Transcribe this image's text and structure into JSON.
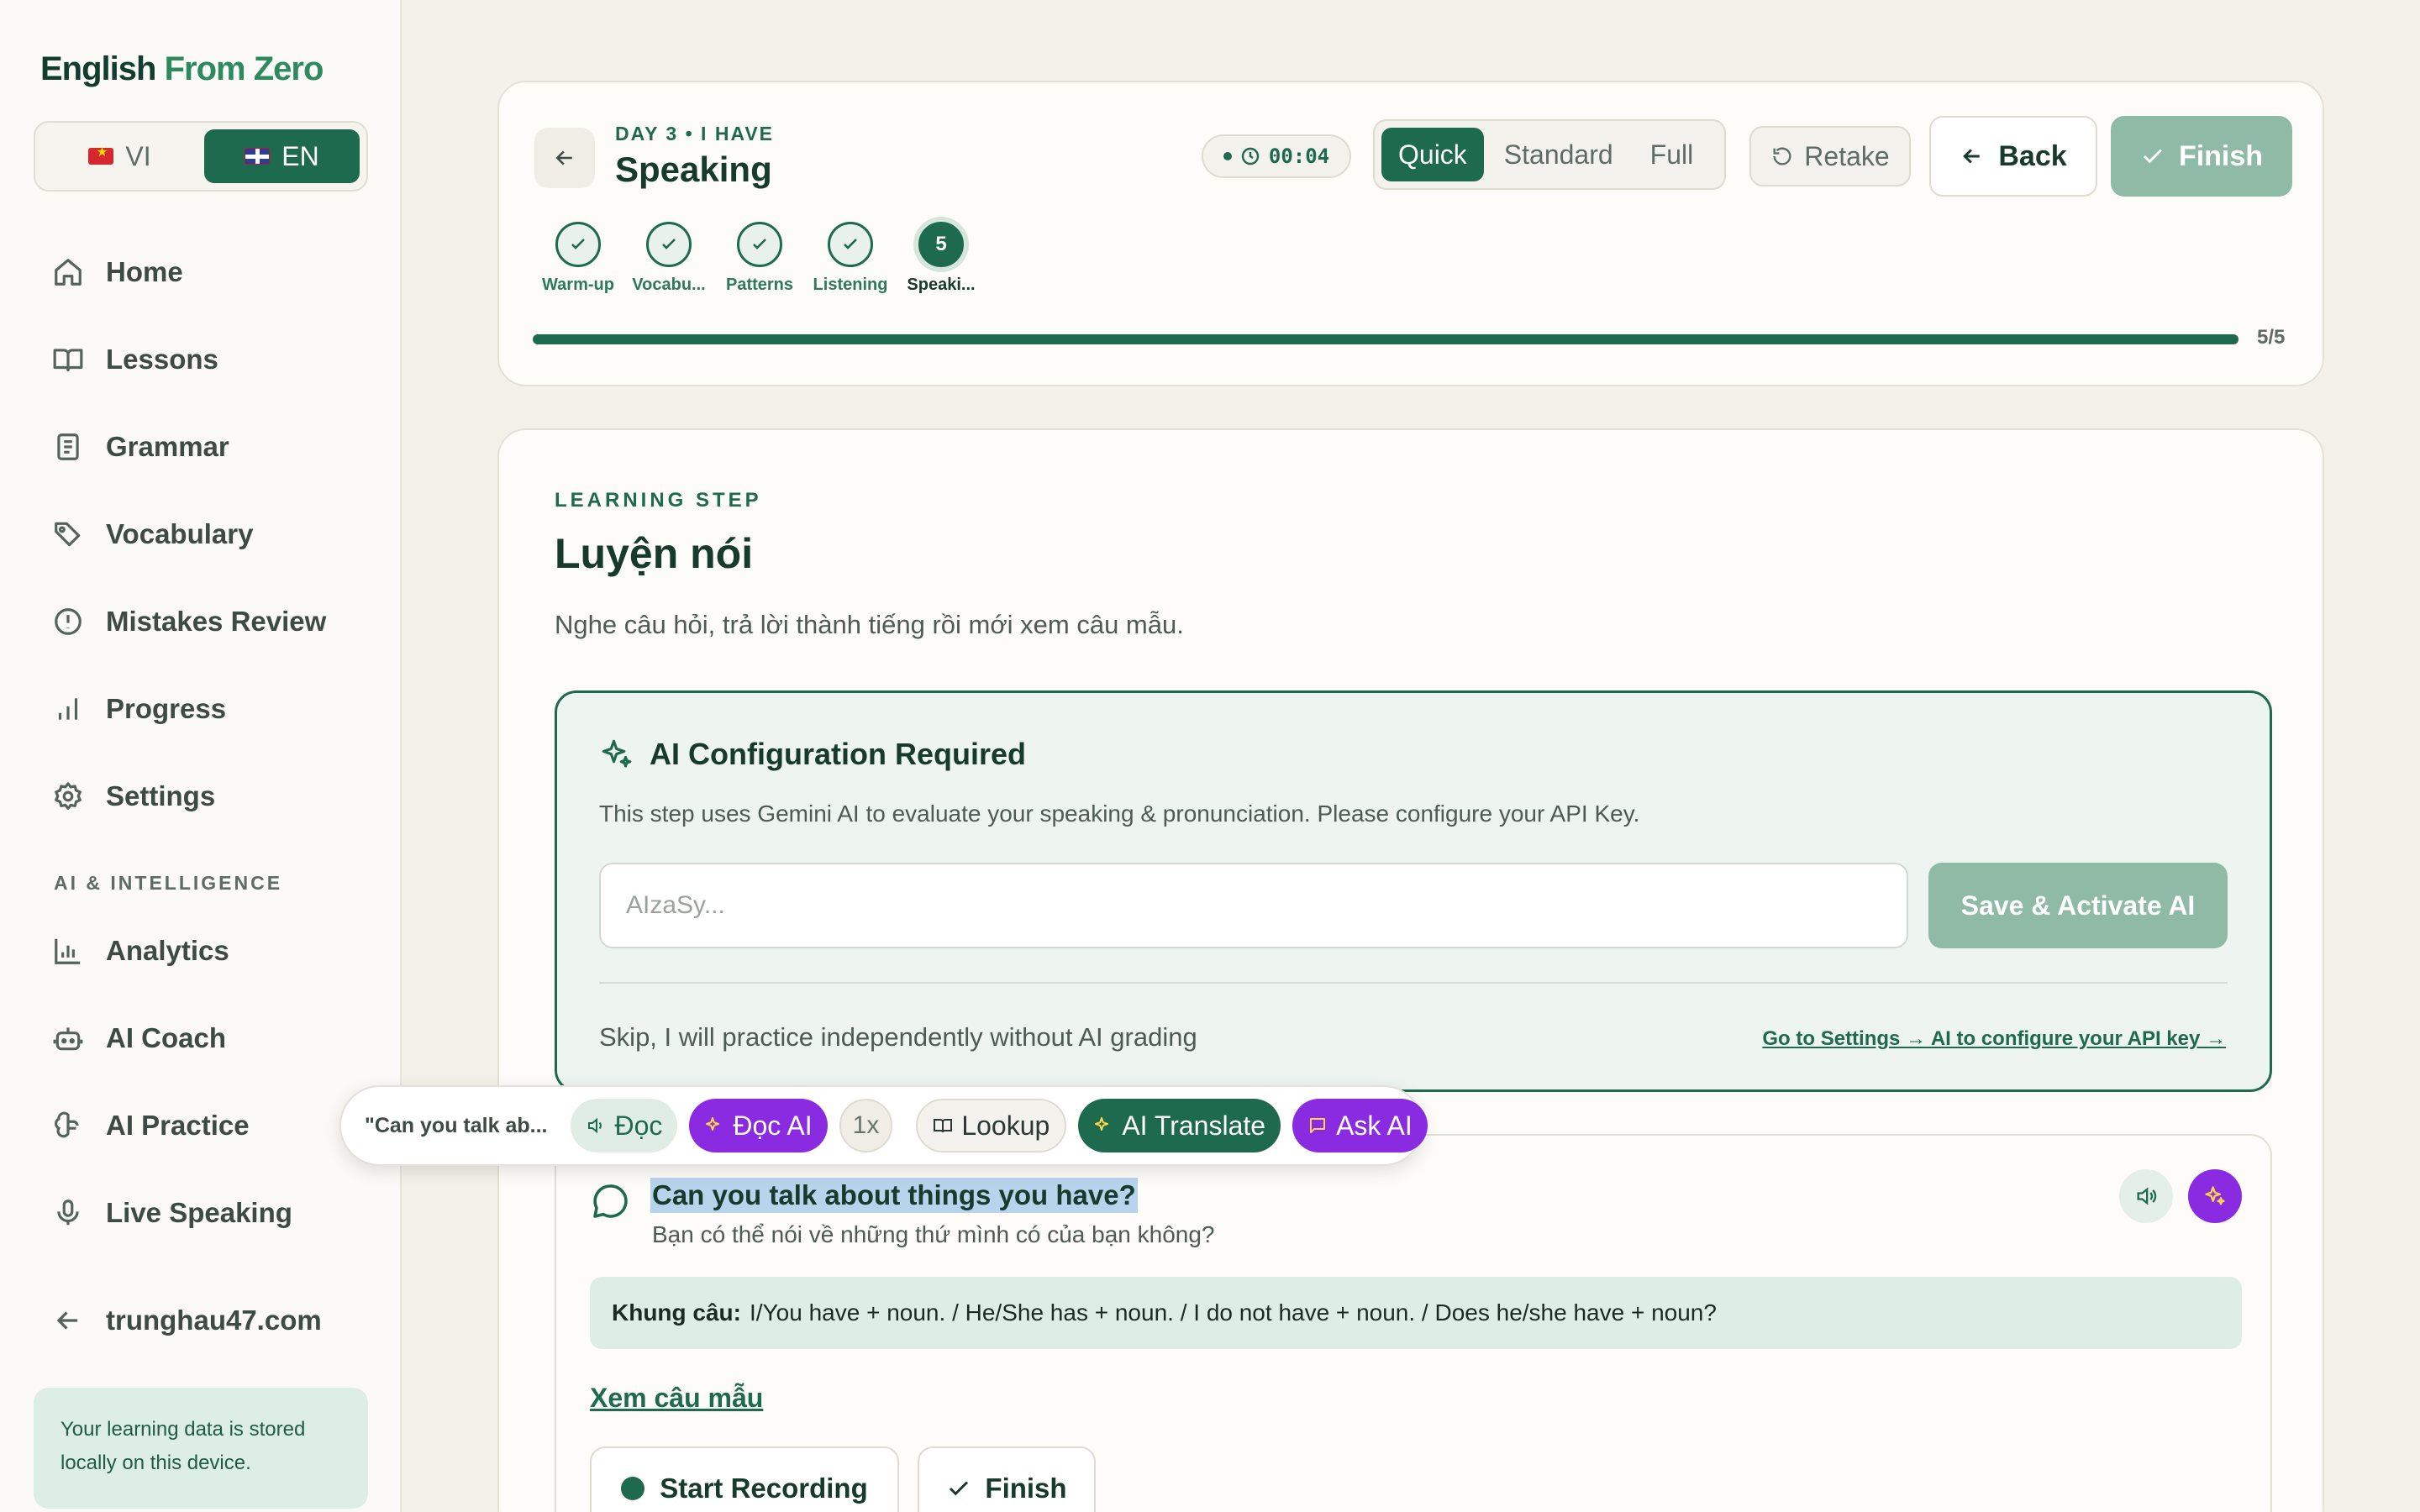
{
  "sidebar": {
    "brand": {
      "part1": "English",
      "part2": "From Zero"
    },
    "lang": {
      "vi": "VI",
      "en": "EN"
    },
    "nav": [
      {
        "label": "Home",
        "icon": "home-icon"
      },
      {
        "label": "Lessons",
        "icon": "book-open-icon"
      },
      {
        "label": "Grammar",
        "icon": "document-icon"
      },
      {
        "label": "Vocabulary",
        "icon": "tags-icon"
      },
      {
        "label": "Mistakes Review",
        "icon": "alert-circle-icon"
      },
      {
        "label": "Progress",
        "icon": "bar-chart-icon"
      },
      {
        "label": "Settings",
        "icon": "gear-icon"
      }
    ],
    "section_ai": "AI & INTELLIGENCE",
    "nav_ai": [
      {
        "label": "Analytics",
        "icon": "analytics-icon"
      },
      {
        "label": "AI Coach",
        "icon": "robot-icon"
      },
      {
        "label": "AI Practice",
        "icon": "brain-icon"
      },
      {
        "label": "Live Speaking",
        "icon": "microphone-icon"
      }
    ],
    "external": {
      "label": "trunghau47.com",
      "icon": "arrow-left-icon"
    },
    "storage_note": "Your learning data is stored locally on this device."
  },
  "header": {
    "day_label": "DAY 3 • I HAVE",
    "title": "Speaking",
    "timer": "00:04",
    "modes": [
      "Quick",
      "Standard",
      "Full"
    ],
    "active_mode": "Quick",
    "retake": "Retake",
    "back": "Back",
    "finish": "Finish",
    "steps": [
      {
        "label": "Warm-up",
        "done": true
      },
      {
        "label": "Vocabu...",
        "done": true
      },
      {
        "label": "Patterns",
        "done": true
      },
      {
        "label": "Listening",
        "done": true
      },
      {
        "label": "Speaki...",
        "done": false,
        "number": "5"
      }
    ],
    "progress": {
      "text": "5/5",
      "fraction": 1.0
    }
  },
  "main": {
    "eyebrow": "LEARNING STEP",
    "title": "Luyện nói",
    "subtitle": "Nghe câu hỏi, trả lời thành tiếng rồi mới xem câu mẫu.",
    "ai_config": {
      "title": "AI Configuration Required",
      "description": "This step uses Gemini AI to evaluate your speaking & pronunciation. Please configure your API Key.",
      "input_placeholder": "AIzaSy...",
      "save_button": "Save & Activate AI",
      "skip_text": "Skip, I will practice independently without AI grading",
      "settings_link": "Go to Settings → AI to configure your API key →"
    },
    "question": {
      "text": "Can you talk about things you have?",
      "translation": "Bạn có thể nói về những thứ mình có của bạn không?",
      "frame_label": "Khung câu:",
      "frame_text": "I/You have + noun. / He/She has + noun. / I do not have + noun. / Does he/she have + noun?",
      "sample_link": "Xem câu mẫu",
      "record_button": "Start Recording",
      "finish_button": "Finish"
    }
  },
  "toolbar": {
    "snippet": "\"Can you talk ab...",
    "doc": "Đọc",
    "doc_ai": "Đọc AI",
    "speed": "1x",
    "lookup": "Lookup",
    "translate": "AI Translate",
    "ask": "Ask AI"
  },
  "colors": {
    "accent": "#1e6a4f",
    "accent_muted": "#8fbba6",
    "ai_purple": "#8a2be2",
    "background": "#f3f1ea"
  }
}
